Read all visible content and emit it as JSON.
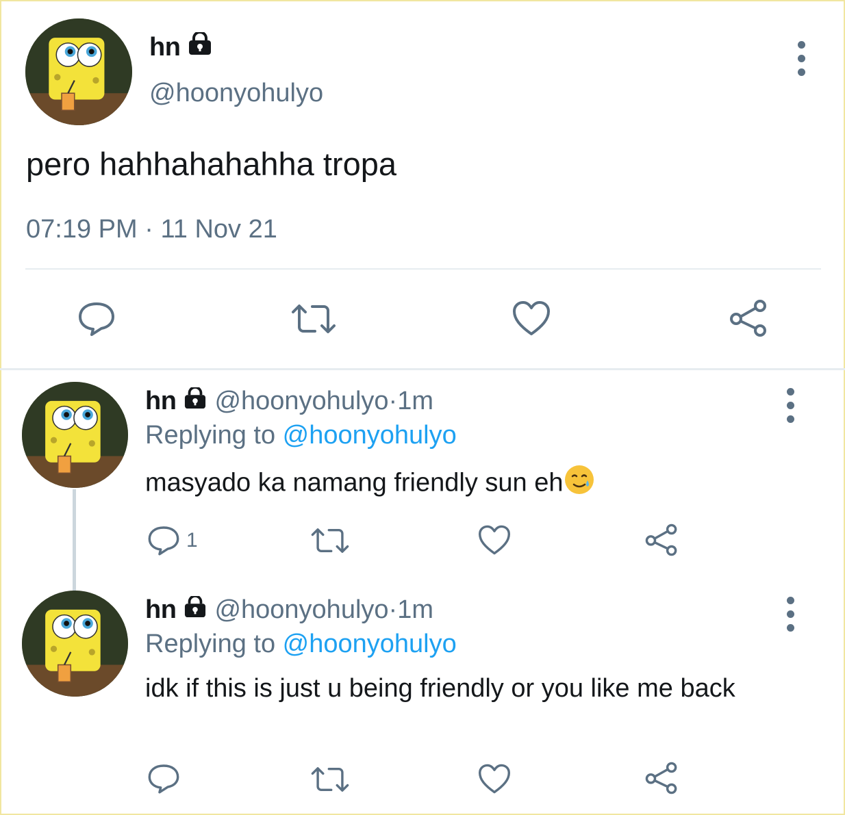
{
  "main_tweet": {
    "name": "hn",
    "handle": "@hoonyohulyo",
    "text": "pero hahhahahahha tropa",
    "time": "07:19 PM",
    "date": "11 Nov 21",
    "time_sep": " · "
  },
  "replies": [
    {
      "name": "hn",
      "handle": "@hoonyohulyo",
      "ago": "1m",
      "sep": " · ",
      "replying_label": "Replying to ",
      "replying_to": "@hoonyohulyo",
      "text": "masyado ka namang friendly sun eh",
      "emoji": "smiling-face-with-tear",
      "reply_count": "1"
    },
    {
      "name": "hn",
      "handle": "@hoonyohulyo",
      "ago": "1m",
      "sep": " · ",
      "replying_label": "Replying to ",
      "replying_to": "@hoonyohulyo",
      "text": "idk if this is just u being friendly or you like me back",
      "reply_count": ""
    }
  ],
  "icons": {
    "reply": "speech-bubble-icon",
    "retweet": "retweet-icon",
    "like": "heart-icon",
    "share": "share-icon",
    "lock": "lock-icon",
    "more": "more-vertical-icon"
  },
  "colors": {
    "text": "#14171a",
    "secondary": "#5b7083",
    "link": "#1da1f2",
    "divider": "#e6ecf0"
  }
}
